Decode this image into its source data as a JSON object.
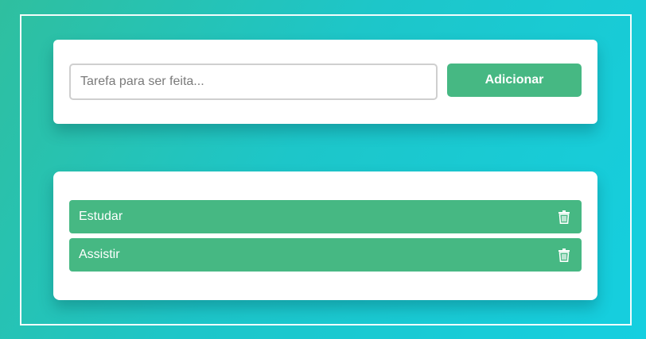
{
  "new_task": {
    "placeholder": "Tarefa para ser feita...",
    "value": "",
    "add_label": "Adicionar"
  },
  "tasks": [
    {
      "label": "Estudar",
      "delete_icon": "trash-icon"
    },
    {
      "label": "Assistir",
      "delete_icon": "trash-icon"
    }
  ],
  "colors": {
    "accent": "#46b883",
    "background_start": "#2fbf9f",
    "background_end": "#15cfe0"
  }
}
